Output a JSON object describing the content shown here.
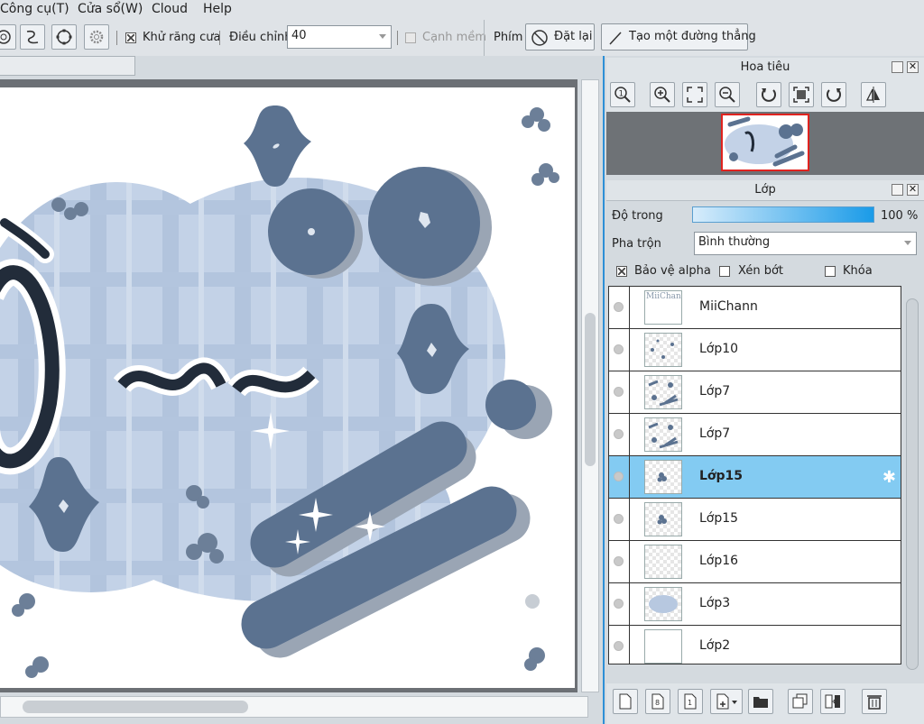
{
  "menu": {
    "tools": "Công cụ(T)",
    "window": "Cửa sổ(W)",
    "cloud": "Cloud",
    "help": "Help"
  },
  "toolbar": {
    "antialias_label": "Khử răng cưa",
    "adjust_label": "Điều chỉnh",
    "adjust_value": "40",
    "soft_edge_label": "Cạnh mềm",
    "key_label": "Phím",
    "reset_label": "Đặt lại",
    "straight_line_label": "Tạo một đường thẳng"
  },
  "navigator": {
    "title": "Hoa tiêu"
  },
  "layers_panel": {
    "title": "Lớp",
    "opacity_label": "Độ trong",
    "opacity_value": "100 %",
    "opacity_fraction": 1.0,
    "blend_label": "Pha trộn",
    "blend_value": "Bình thường",
    "protect_alpha_label": "Bảo vệ alpha",
    "clip_label": "Xén bớt",
    "lock_label": "Khóa",
    "layers": [
      {
        "name": "MiiChann",
        "thumb": "text"
      },
      {
        "name": "Lớp10",
        "thumb": "dots"
      },
      {
        "name": "Lớp7",
        "thumb": "bars"
      },
      {
        "name": "Lớp7",
        "thumb": "bars"
      },
      {
        "name": "Lớp15",
        "thumb": "flower",
        "selected": true
      },
      {
        "name": "Lớp15",
        "thumb": "flower"
      },
      {
        "name": "Lớp16",
        "thumb": "empty"
      },
      {
        "name": "Lớp3",
        "thumb": "cloud"
      },
      {
        "name": "Lớp2",
        "thumb": "white"
      }
    ]
  },
  "thumb_text": "MiiChann",
  "colors": {
    "accent": "#2d8fd6",
    "selection": "#83cbf2",
    "shape": "#5b7290",
    "cloud": "#c5d4e8"
  }
}
